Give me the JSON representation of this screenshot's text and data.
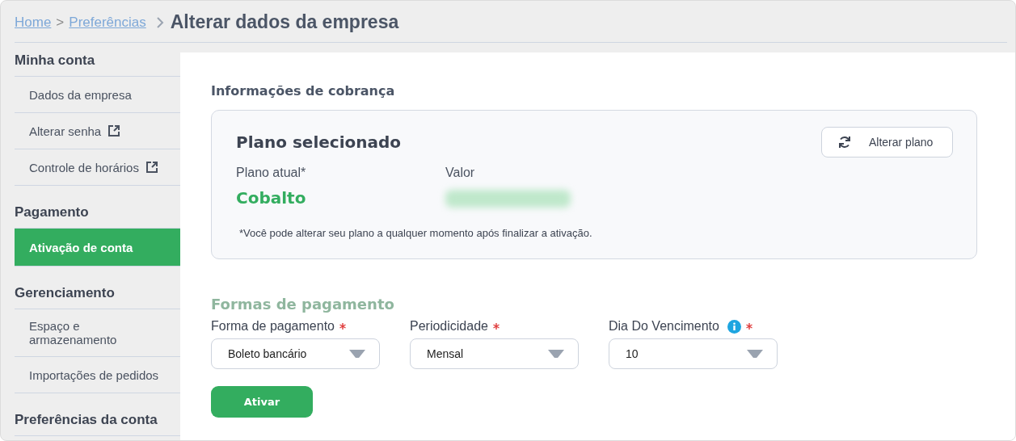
{
  "breadcrumb": {
    "links": [
      "Home",
      "Preferências"
    ],
    "separator": ">",
    "current": "Alterar dados da empresa"
  },
  "sidebar": {
    "sections": [
      {
        "title": "Minha conta",
        "items": [
          {
            "label": "Dados da empresa",
            "external": false,
            "selected": false
          },
          {
            "label": "Alterar senha",
            "external": true,
            "selected": false
          },
          {
            "label": "Controle de horários",
            "external": true,
            "selected": false
          }
        ]
      },
      {
        "title": "Pagamento",
        "items": [
          {
            "label": "Ativação de conta",
            "external": false,
            "selected": true
          }
        ]
      },
      {
        "title": "Gerenciamento",
        "items": [
          {
            "label": "Espaço e armazenamento",
            "external": false,
            "selected": false
          },
          {
            "label": "Importações de pedidos",
            "external": false,
            "selected": false
          }
        ]
      },
      {
        "title": "Preferências da conta"
      }
    ]
  },
  "billing": {
    "title": "Informações de cobrança",
    "plan_card": {
      "title": "Plano selecionado",
      "change_button": "Alterar plano",
      "current_label": "Plano atual*",
      "current_value": "Cobalto",
      "price_label": "Valor",
      "note": "*Você pode alterar seu plano a qualquer momento após finalizar a ativação."
    }
  },
  "payment": {
    "title": "Formas de pagamento",
    "fields": [
      {
        "label": "Forma de pagamento",
        "required": true,
        "info": false,
        "value": "Boleto bancário"
      },
      {
        "label": "Periodicidade",
        "required": true,
        "info": false,
        "value": "Mensal"
      },
      {
        "label": "Dia Do Vencimento",
        "required": true,
        "info": true,
        "value": "10"
      }
    ],
    "submit": "Ativar"
  }
}
